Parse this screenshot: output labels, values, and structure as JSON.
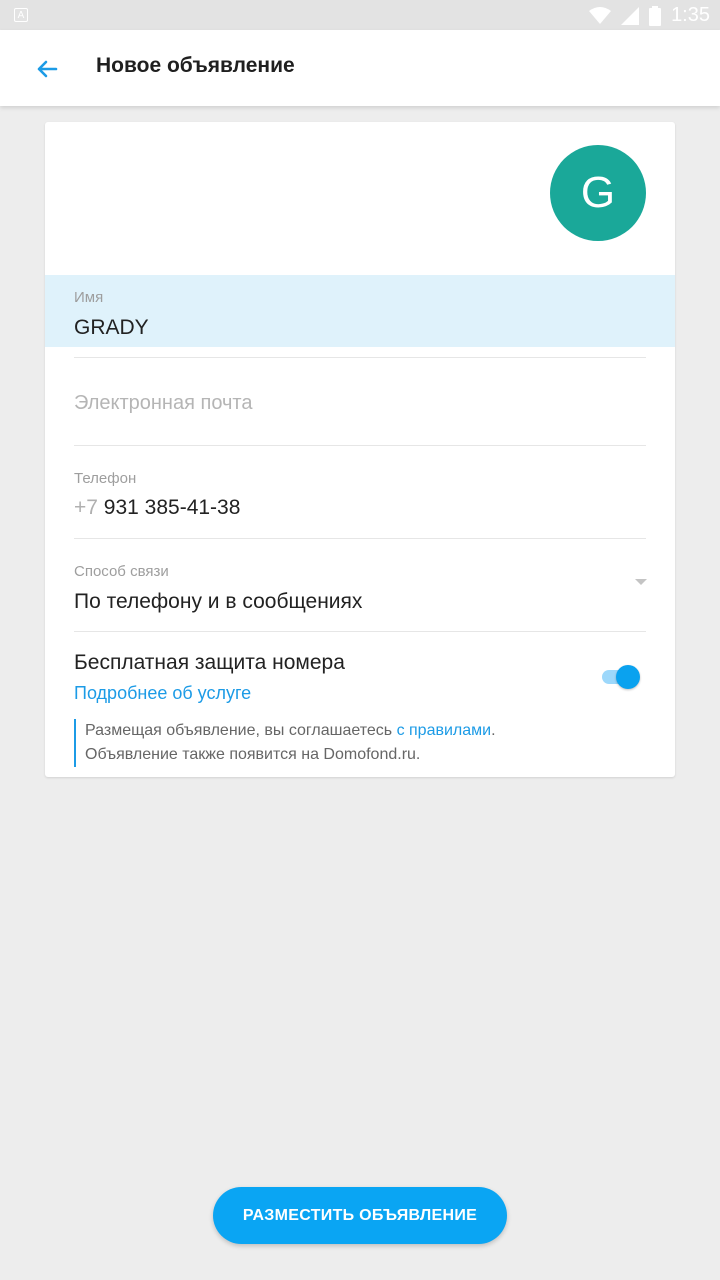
{
  "status_bar": {
    "time": "1:35",
    "icons": [
      "notification-icon",
      "wifi-icon",
      "signal-icon",
      "battery-icon"
    ]
  },
  "app_bar": {
    "title": "Новое объявление",
    "back_icon": "arrow-left-icon"
  },
  "profile": {
    "avatar_letter": "G",
    "avatar_color": "#1aa899"
  },
  "form": {
    "name": {
      "label": "Имя",
      "value": "GRADY"
    },
    "email": {
      "placeholder": "Электронная почта",
      "value": ""
    },
    "phone": {
      "label": "Телефон",
      "prefix": "+7",
      "value": "931 385-41-38"
    },
    "contact_method": {
      "label": "Способ связи",
      "value": "По телефону и в сообщениях"
    },
    "protection": {
      "title": "Бесплатная защита номера",
      "link": "Подробнее об услуге",
      "enabled": true
    },
    "terms": {
      "text_before": "Размещая объявление, вы соглашаетесь ",
      "link": "с правилами",
      "text_after": ".",
      "line2": "Объявление также появится на Domofond.ru."
    }
  },
  "submit_button": {
    "label": "РАЗМЕСТИТЬ ОБЪЯВЛЕНИЕ"
  },
  "colors": {
    "accent": "#0aa5f3",
    "link": "#1c9be6",
    "background": "#ededed"
  }
}
